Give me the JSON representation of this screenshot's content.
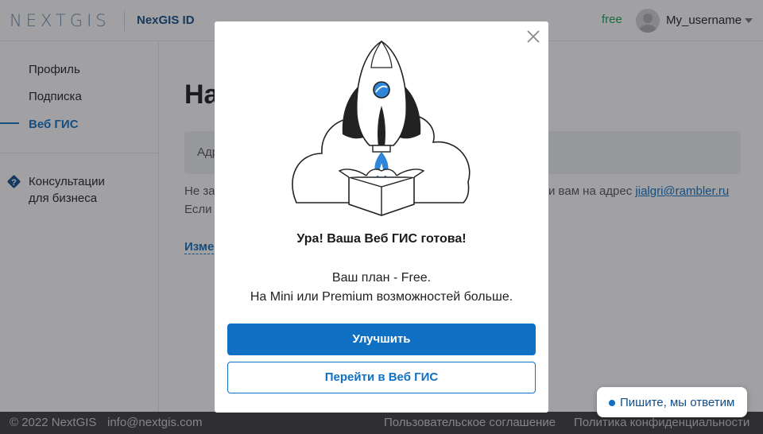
{
  "header": {
    "logo": "NEXTGIS",
    "app_name": "NexGIS ID",
    "plan": "free",
    "username": "My_username"
  },
  "sidebar": {
    "items": [
      {
        "label": "Профиль"
      },
      {
        "label": "Подписка"
      },
      {
        "label": "Веб ГИС"
      }
    ],
    "help_label_line1": "Консультации",
    "help_label_line2": "для бизнеса"
  },
  "main": {
    "title_fragment": "На",
    "address_label_fragment": "Адр",
    "info_line1_start": "Не за",
    "info_line1_end": "и вам на адрес",
    "email": "jialgri@rambler.ru",
    "info_line2_start": "Если",
    "change_link_fragment": "Изме"
  },
  "modal": {
    "title": "Ура! Ваша Веб ГИС готова!",
    "plan_text": "Ваш план - Free.",
    "upsell_text": "На Mini или Premium возможностей больше.",
    "upgrade_button": "Улучшить",
    "open_button": "Перейти в Веб ГИС"
  },
  "footer": {
    "copyright": "© 2022 NextGIS",
    "email": "info@nextgis.com",
    "terms": "Пользовательское соглашение",
    "privacy": "Политика конфиденциальности"
  },
  "chat": {
    "label": "Пишите, мы ответим"
  },
  "colors": {
    "accent": "#0f70c4",
    "plan_green": "#1ba35a",
    "footer_bg": "#3b3b3b"
  }
}
